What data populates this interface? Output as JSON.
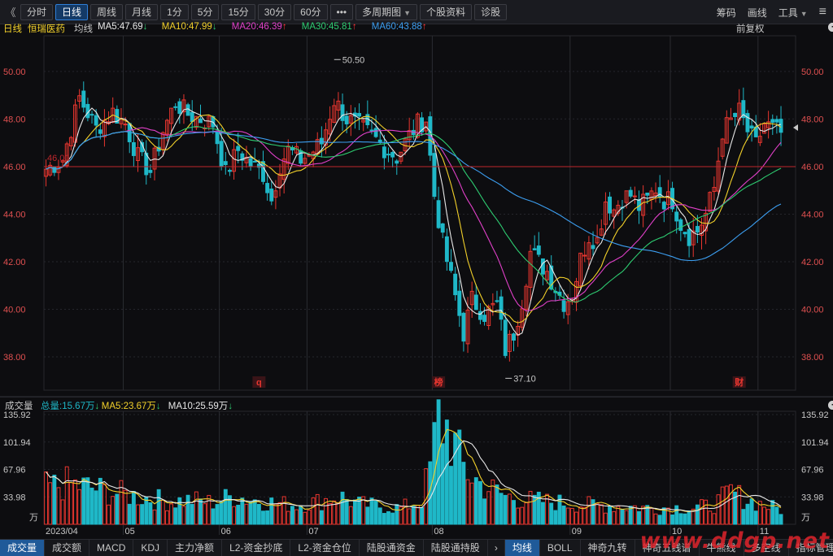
{
  "toolbar": {
    "back": "《",
    "tabs": [
      "分时",
      "日线",
      "周线",
      "月线",
      "1分",
      "5分",
      "15分",
      "30分",
      "60分",
      "•••",
      "多周期图",
      "个股资料",
      "诊股"
    ],
    "active": "日线",
    "right": [
      "筹码",
      "画线",
      "工具"
    ]
  },
  "ma_header": {
    "period": "日线",
    "stock": "恒瑞医药",
    "mode": "均线",
    "items": [
      {
        "label": "MA5:47.69",
        "color": "#e8e8e8",
        "arrow": "↓",
        "arrow_color": "#2ecc71"
      },
      {
        "label": "MA10:47.99",
        "color": "#f2d02a",
        "arrow": "↓",
        "arrow_color": "#2ecc71"
      },
      {
        "label": "MA20:46.39",
        "color": "#e040c8",
        "arrow": "↑",
        "arrow_color": "#ff3333"
      },
      {
        "label": "MA30:45.81",
        "color": "#2ecc71",
        "arrow": "↑",
        "arrow_color": "#ff3333"
      },
      {
        "label": "MA60:43.88",
        "color": "#3c9ef0",
        "arrow": "↑",
        "arrow_color": "#ff3333"
      }
    ],
    "right_label": "前复权"
  },
  "vol_header": {
    "title": "成交量",
    "items": [
      {
        "label": "总量:15.67万",
        "color": "#1fb8c8",
        "arrow": "↓",
        "arrow_color": "#2ecc71"
      },
      {
        "label": "MA5:23.67万",
        "color": "#f2d02a",
        "arrow": "↓",
        "arrow_color": "#2ecc71"
      },
      {
        "label": "MA10:25.59万",
        "color": "#e8e8e8",
        "arrow": "↓",
        "arrow_color": "#2ecc71"
      }
    ]
  },
  "bottom_tabs": [
    "成交量",
    "成交额",
    "MACD",
    "KDJ",
    "主力净额",
    "L2-资金抄底",
    "L2-资金仓位",
    "陆股通资金",
    "陆股通持股",
    "均线",
    "BOLL",
    "神奇九转",
    "神奇五线谱",
    "牛熊线",
    "多空线",
    "指标管理"
  ],
  "bottom_active": [
    "成交量",
    "均线"
  ],
  "bottom_arrow": "›",
  "watermark": "www.ddgp.net",
  "chart_data": {
    "type": "candlestick",
    "price_axis": {
      "ticks": [
        "50.00",
        "48.00",
        "46.00",
        "44.00",
        "42.00",
        "40.00",
        "38.00"
      ],
      "ylim": [
        36.6,
        51.5
      ]
    },
    "volume_axis": {
      "ticks": [
        "135.92",
        "101.94",
        "67.96",
        "33.98"
      ],
      "unit": "万",
      "ylim": [
        0,
        140
      ]
    },
    "x_labels": [
      "2023/04",
      "05",
      "06",
      "07",
      "08",
      "09",
      "10",
      "11"
    ],
    "x_label_index": [
      0,
      19,
      42,
      63,
      93,
      126,
      150,
      171
    ],
    "annotations": {
      "high": "50.50",
      "low": "37.10",
      "price_line": "46.00",
      "price_line_label": "46.00"
    },
    "event_markers": [
      {
        "label": "q",
        "index": 51
      },
      {
        "label": "榜",
        "index": 94
      },
      {
        "label": "财",
        "index": 166
      }
    ],
    "ma_colors": {
      "MA5": "#e8e8e8",
      "MA10": "#f2d02a",
      "MA20": "#e040c8",
      "MA30": "#2ecc71",
      "MA60": "#3c9ef0"
    },
    "close_anchors": [
      [
        0,
        45.9
      ],
      [
        4,
        46.3
      ],
      [
        8,
        48.9
      ],
      [
        12,
        47.6
      ],
      [
        16,
        48.3
      ],
      [
        19,
        47.8
      ],
      [
        22,
        46.4
      ],
      [
        25,
        45.8
      ],
      [
        28,
        47.5
      ],
      [
        31,
        48.7
      ],
      [
        34,
        48.2
      ],
      [
        37,
        48.0
      ],
      [
        40,
        47.8
      ],
      [
        43,
        45.7
      ],
      [
        46,
        46.7
      ],
      [
        49,
        46.1
      ],
      [
        52,
        45.7
      ],
      [
        54,
        44.6
      ],
      [
        56,
        46.1
      ],
      [
        58,
        46.7
      ],
      [
        61,
        46.3
      ],
      [
        63,
        46.5
      ],
      [
        66,
        47.0
      ],
      [
        69,
        48.8
      ],
      [
        72,
        48.0
      ],
      [
        75,
        47.7
      ],
      [
        78,
        47.3
      ],
      [
        81,
        46.8
      ],
      [
        84,
        46.4
      ],
      [
        87,
        47.3
      ],
      [
        89,
        47.8
      ],
      [
        91,
        48.0
      ],
      [
        93,
        44.8
      ],
      [
        95,
        42.8
      ],
      [
        97,
        41.3
      ],
      [
        100,
        39.0
      ],
      [
        102,
        40.4
      ],
      [
        105,
        39.8
      ],
      [
        108,
        40.2
      ],
      [
        110,
        38.3
      ],
      [
        112,
        39.0
      ],
      [
        114,
        40.4
      ],
      [
        116,
        42.4
      ],
      [
        118,
        42.0
      ],
      [
        120,
        41.6
      ],
      [
        122,
        40.9
      ],
      [
        124,
        40.3
      ],
      [
        126,
        40.6
      ],
      [
        128,
        42.1
      ],
      [
        130,
        43.1
      ],
      [
        132,
        42.9
      ],
      [
        134,
        44.6
      ],
      [
        136,
        44.2
      ],
      [
        138,
        44.7
      ],
      [
        140,
        44.8
      ],
      [
        142,
        44.3
      ],
      [
        144,
        44.6
      ],
      [
        146,
        45.1
      ],
      [
        148,
        44.6
      ],
      [
        150,
        44.6
      ],
      [
        152,
        43.6
      ],
      [
        154,
        43.1
      ],
      [
        156,
        43.3
      ],
      [
        158,
        44.0
      ],
      [
        160,
        45.1
      ],
      [
        162,
        47.5
      ],
      [
        164,
        47.9
      ],
      [
        166,
        48.3
      ],
      [
        168,
        47.5
      ],
      [
        170,
        46.9
      ],
      [
        172,
        47.8
      ],
      [
        174,
        47.6
      ],
      [
        176,
        47.4
      ]
    ],
    "volume_anchors": [
      [
        0,
        45
      ],
      [
        5,
        50
      ],
      [
        10,
        46
      ],
      [
        15,
        40
      ],
      [
        20,
        36
      ],
      [
        25,
        32
      ],
      [
        30,
        28
      ],
      [
        35,
        30
      ],
      [
        40,
        27
      ],
      [
        45,
        35
      ],
      [
        50,
        30
      ],
      [
        55,
        26
      ],
      [
        60,
        24
      ],
      [
        65,
        28
      ],
      [
        70,
        35
      ],
      [
        75,
        25
      ],
      [
        80,
        22
      ],
      [
        85,
        20
      ],
      [
        90,
        30
      ],
      [
        92,
        70
      ],
      [
        94,
        130
      ],
      [
        96,
        120
      ],
      [
        98,
        95
      ],
      [
        100,
        70
      ],
      [
        104,
        50
      ],
      [
        110,
        35
      ],
      [
        115,
        30
      ],
      [
        120,
        28
      ],
      [
        125,
        26
      ],
      [
        130,
        24
      ],
      [
        135,
        23
      ],
      [
        140,
        22
      ],
      [
        145,
        20
      ],
      [
        150,
        21
      ],
      [
        155,
        20
      ],
      [
        160,
        24
      ],
      [
        164,
        40
      ],
      [
        168,
        30
      ],
      [
        172,
        24
      ],
      [
        176,
        18
      ]
    ]
  }
}
